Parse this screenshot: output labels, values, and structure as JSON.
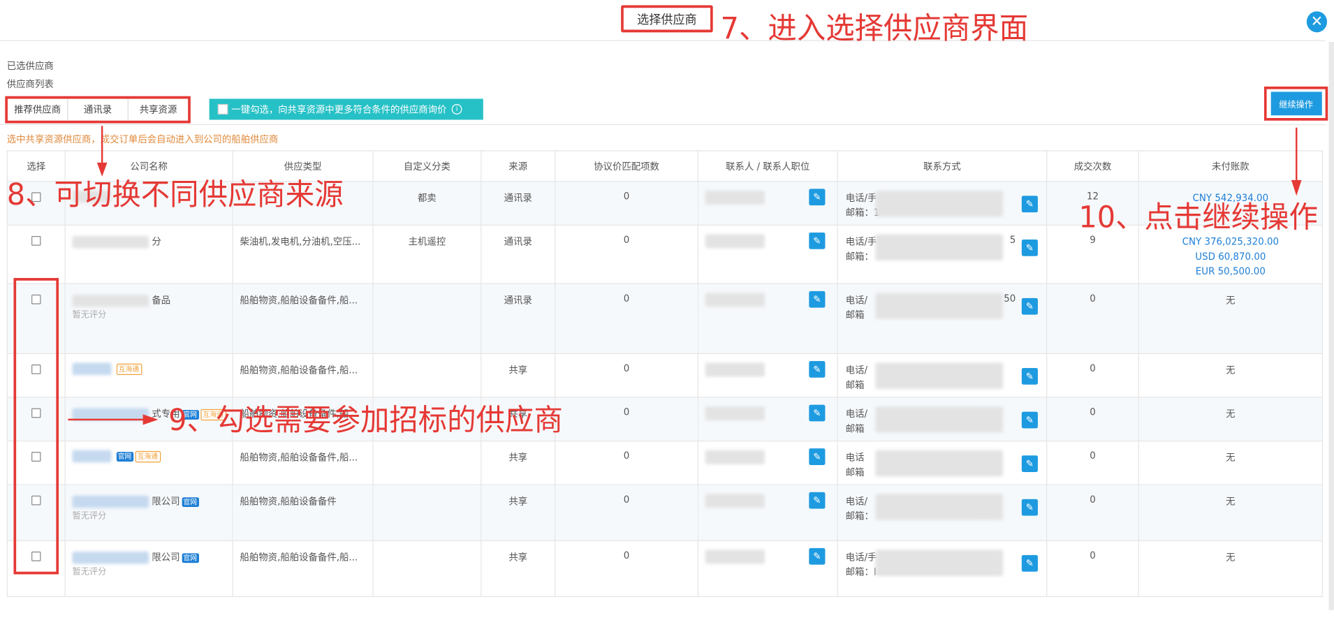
{
  "dialog": {
    "title": "选择供应商",
    "close_icon": "✕"
  },
  "labels": {
    "selected_suppliers": "已选供应商",
    "supplier_list": "供应商列表"
  },
  "tabs": [
    {
      "label": "推荐供应商"
    },
    {
      "label": "通讯录"
    },
    {
      "label": "共享资源"
    }
  ],
  "share_bar": {
    "label": "一键勾选，向共享资源中更多符合条件的供应商询价",
    "info_icon": "i"
  },
  "continue_button": {
    "label": "继续操作"
  },
  "notice": "选中共享资源供应商，成交订单后会自动进入到公司的船舶供应商",
  "table": {
    "headers": [
      "选择",
      "公司名称",
      "供应类型",
      "自定义分类",
      "来源",
      "协议价匹配项数",
      "联系人 / 联系人职位",
      "联系方式",
      "成交次数",
      "未付账款"
    ],
    "rows": [
      {
        "name_suffix": "",
        "sub": "",
        "supply": "",
        "custom": "都卖",
        "source": "通讯录",
        "match": "0",
        "contact_lines": [
          "电话/手",
          "邮箱：1"
        ],
        "deals": "12",
        "debts": [
          {
            "cur": "CNY",
            "amt": "542,934.00"
          }
        ],
        "none": ""
      },
      {
        "name_suffix": "分",
        "sub": "",
        "supply": "柴油机,发电机,分油机,空压...",
        "custom": "主机遥控",
        "source": "通讯录",
        "match": "0",
        "contact_lines": [
          "电话/手",
          "邮箱："
        ],
        "contact_tail": "5",
        "deals": "9",
        "debts": [
          {
            "cur": "CNY",
            "amt": "376,025,320.00"
          },
          {
            "cur": "USD",
            "amt": "60,870.00"
          },
          {
            "cur": "EUR",
            "amt": "50,500.00"
          }
        ],
        "none": ""
      },
      {
        "name_suffix": "备品",
        "sub": "暂无评分",
        "supply": "船舶物资,船舶设备备件,船...",
        "custom": "",
        "source": "通讯录",
        "match": "0",
        "contact_lines": [
          "电话/",
          "邮箱"
        ],
        "contact_tail": "50",
        "deals": "0",
        "debts": [],
        "none": "无"
      },
      {
        "name_suffix": "",
        "tag2": "互海通",
        "sub": "",
        "supply": "船舶物资,船舶设备备件,船...",
        "custom": "",
        "source": "共享",
        "match": "0",
        "contact_lines": [
          "电话/",
          "邮箱"
        ],
        "deals": "0",
        "debts": [],
        "none": "无"
      },
      {
        "name_suffix": "式专用",
        "tag1": "官网",
        "tag2": "互海通",
        "sub": "",
        "supply": "船舶物资,船舶设备备件,船...",
        "custom": "",
        "source": "共享",
        "match": "0",
        "contact_lines": [
          "电话/",
          "邮箱"
        ],
        "deals": "0",
        "debts": [],
        "none": "无"
      },
      {
        "name_suffix": "",
        "tag1": "官网",
        "tag2": "互海通",
        "sub": "",
        "supply": "船舶物资,船舶设备备件,船...",
        "custom": "",
        "source": "共享",
        "match": "0",
        "contact_lines": [
          "电话",
          "邮箱"
        ],
        "deals": "0",
        "debts": [],
        "none": "无"
      },
      {
        "name_suffix": "限公司",
        "tag1": "官网",
        "sub": "暂无评分",
        "supply": "船舶物资,船舶设备备件",
        "custom": "",
        "source": "共享",
        "match": "0",
        "contact_lines": [
          "电话/",
          "邮箱："
        ],
        "deals": "0",
        "debts": [],
        "none": "无"
      },
      {
        "name_suffix": "限公司",
        "tag1": "官网",
        "sub": "暂无评分",
        "supply": "船舶物资,船舶设备备件,船...",
        "custom": "",
        "source": "共享",
        "match": "0",
        "contact_lines": [
          "电话/手",
          "邮箱：I"
        ],
        "deals": "0",
        "debts": [],
        "none": "无"
      }
    ]
  },
  "annotations": {
    "step7": "7、进入选择供应商界面",
    "step8": "8、可切换不同供应商来源",
    "step9": "9、勾选需要参加招标的供应商",
    "step10": "10、点击继续操作"
  },
  "colors": {
    "accent": "#1e9be0",
    "annotation_red": "#e53935",
    "share_teal": "#26c1c6",
    "notice_orange": "#e08a3c"
  },
  "icons": {
    "close": "close-icon",
    "edit": "pencil-icon",
    "info": "info-icon"
  }
}
